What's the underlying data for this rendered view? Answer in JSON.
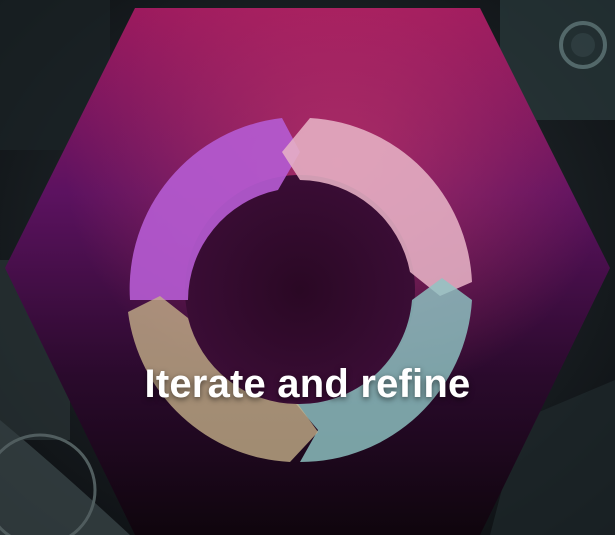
{
  "slide": {
    "caption": "Iterate and refine",
    "icon": "refresh-cycle-icon",
    "colors": {
      "hex_top": "#a8195c",
      "hex_mid": "#5a0f5e",
      "hex_bottom": "#12050f",
      "arrow_purple": "#b45ad0",
      "arrow_pink": "#e8b3c4",
      "arrow_teal": "#8ec6c5",
      "arrow_tan": "#c9b48a",
      "background": "#0d0f12"
    }
  }
}
